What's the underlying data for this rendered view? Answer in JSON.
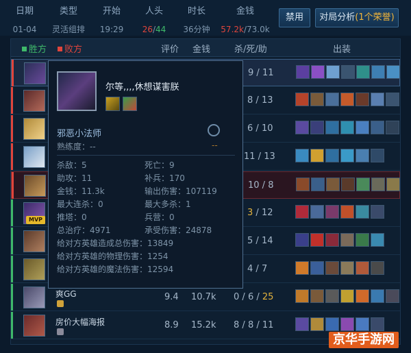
{
  "header": {
    "columns": [
      {
        "label": "日期",
        "value": "01-04"
      },
      {
        "label": "类型",
        "value": "灵活组排"
      },
      {
        "label": "开始",
        "value": "19:29"
      },
      {
        "label": "人头",
        "kills_red": "26",
        "sep": "/",
        "kills_green": "44"
      },
      {
        "label": "时长",
        "value": "36分钟"
      },
      {
        "label": "金钱",
        "gold_red": "57.2k",
        "sep": "/",
        "gold_other": "73.0k"
      }
    ],
    "ban_button": "禁用",
    "analysis_button": "对局分析",
    "analysis_badge": "(1个荣誉)"
  },
  "table": {
    "legend_win": "胜方",
    "legend_lose": "败方",
    "headers": [
      "评价",
      "金钱",
      "杀/死/助",
      "出装"
    ],
    "rows": [
      {
        "kda_d": "9",
        "kda_a": "11"
      },
      {
        "kda_d": "8",
        "kda_a": "13"
      },
      {
        "kda_d": "6",
        "kda_a": "10"
      },
      {
        "kda_d": "11",
        "kda_a": "13"
      },
      {
        "kda_d": "10",
        "kda_a": "8"
      },
      {
        "kda_d": "3",
        "kda_a": "12"
      },
      {
        "kda_d": "5",
        "kda_a": "14"
      },
      {
        "kda_d": "4",
        "kda_a": "7"
      },
      {
        "name": "爽GG",
        "score": "9.4",
        "gold": "10.7k",
        "kda_k": "0",
        "kda_d": "6",
        "kda_a": "25"
      },
      {
        "name": "房价大幅海报",
        "score": "8.9",
        "gold": "15.2k",
        "kda_k": "8",
        "kda_d": "8",
        "kda_a": "11"
      }
    ],
    "mvp": "MVP"
  },
  "popup": {
    "player_name": "尔等,,,,休想谋害朕",
    "champion": "邪恶小法师",
    "proficiency": "熟练度：--",
    "rank_dash": "--",
    "stats": {
      "kills": "杀敌：5",
      "deaths": "死亡：9",
      "assists": "助攻：11",
      "cs": "补兵：170",
      "gold": "金钱：11.3k",
      "damage": "输出伤害：107119",
      "max_streak": "最大连杀：0",
      "max_multi": "最大多杀：1",
      "towers": "推塔：0",
      "barracks": "兵营：0",
      "healing": "总治疗：4971",
      "taken": "承受伤害：24878",
      "champ_damage": "给对方英雄造成总伤害：13849",
      "physical": "给对方英雄的物理伤害：1254",
      "magic": "给对方英雄的魔法伤害：12594"
    }
  },
  "watermark": "京华手游网",
  "colors": {
    "red": "#e0453c",
    "green": "#3fb96a",
    "accent": "#f2b53a"
  }
}
